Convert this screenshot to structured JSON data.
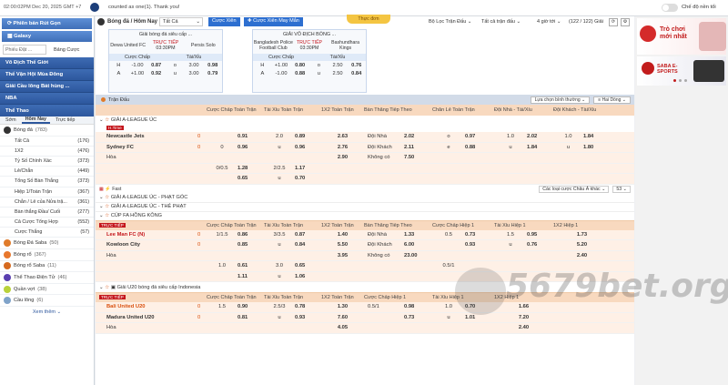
{
  "topbar": {
    "datetime": "02:00:02PM Dec 20, 2025 GMT +7",
    "marquee": "counted as one(1). Thank you!",
    "toggle_label": "Chế độ nền tối"
  },
  "sidebar": {
    "btn1": "Phiên bản Rút Gọn",
    "btn2": "Galaxy",
    "search_placeholder": "Phiếu Đặt ...",
    "betslip": "Bảng Cược",
    "cats": [
      "Vô Địch Thế Giới",
      "Thế Vận Hội Mùa Đông",
      "Giải Cầu lông Bát hùng ...",
      "NBA",
      "Thể Thao"
    ],
    "tabs": [
      "Sớm",
      "Hôm Nay",
      "Trực tiếp"
    ],
    "sport": {
      "name": "Bóng đá",
      "count": "(783)"
    },
    "subs": [
      {
        "l": "Tất Cả",
        "c": "(176)"
      },
      {
        "l": "1X2",
        "c": "(476)"
      },
      {
        "l": "Tỷ Số Chính Xác",
        "c": "(373)"
      },
      {
        "l": "Lẻ/Chẵn",
        "c": "(449)"
      },
      {
        "l": "Tổng Số Bàn Thắng",
        "c": "(373)"
      },
      {
        "l": "Hiệp 1/Toàn Trận",
        "c": "(367)"
      },
      {
        "l": "Chẵn / Lẻ của Nửa trậ...",
        "c": "(361)"
      },
      {
        "l": "Bàn thắng Đầu/ Cuối",
        "c": "(277)"
      },
      {
        "l": "Cả Cược Tổng Hợp",
        "c": "(552)"
      },
      {
        "l": "Cược Thắng",
        "c": "(57)"
      }
    ],
    "sports": [
      {
        "l": "Bóng Đá Saba",
        "c": "(50)"
      },
      {
        "l": "Bóng rổ",
        "c": "(367)"
      },
      {
        "l": "Bóng rổ Saba",
        "c": "(11)"
      },
      {
        "l": "Thể Thao Điện Tử",
        "c": "(46)"
      },
      {
        "l": "Quần vợt",
        "c": "(38)"
      },
      {
        "l": "Cầu lông",
        "c": "(6)"
      }
    ],
    "more": "Xem thêm"
  },
  "header": {
    "title": "Bóng đá / Hôm Nay",
    "filter": "Tất Cả",
    "btn_mix": "Cược Xiên",
    "btn_lucky": "Cược Xiên May Mắn",
    "deposit": "Thực đơn",
    "filter_league": "Bộ Lọc Trận Đấu",
    "filter_all": "Tất cả trận đấu",
    "filter_hours": "4 giờ tới",
    "count": "(122 / 122) Giải"
  },
  "cards": [
    {
      "league": "Giải bóng đá siêu cấp ...",
      "home": "Dewa United FC",
      "away": "Persis Solo",
      "live": "TRỰC TIẾP",
      "time": "03:30PM",
      "hcap": "Cược Chấp",
      "ou": "Tài/Xỉu",
      "r1": [
        "H",
        "-1.00",
        "0.87",
        "o",
        "3.00",
        "0.98"
      ],
      "r2": [
        "A",
        "+1.00",
        "0.92",
        "u",
        "3.00",
        "0.79"
      ]
    },
    {
      "league": "GIẢI VÔ ĐỊCH BÓNG ...",
      "home": "Bangladesh Police Football Club",
      "away": "Bashundhara Kings",
      "live": "TRỰC TIẾP",
      "time": "03:30PM",
      "hcap": "Cược Chấp",
      "ou": "Tài/Xỉu",
      "r1": [
        "H",
        "+1.00",
        "0.80",
        "o",
        "2.50",
        "0.76"
      ],
      "r2": [
        "A",
        "-1.00",
        "0.88",
        "u",
        "2.50",
        "0.84"
      ]
    }
  ],
  "ads": {
    "ad1": "Trò chơi mới nhất",
    "ad2": "SABA E-SPORTS"
  },
  "main": {
    "matches_label": "Trận Đấu",
    "sort": "Lựa chọn bình thường",
    "tab2": "Hai Dòng",
    "cols": [
      "Cược Chấp Toàn Trận",
      "Tài Xỉu Toàn Trận",
      "1X2 Toàn Trận",
      "Bàn Thắng Tiếp Theo",
      "Chẵn Lẻ Toàn Trận",
      "Đội Nhà - Tài/Xỉu",
      "Đội Khách - Tài/Xỉu"
    ],
    "cols2": [
      "Cược Chấp Toàn Trận",
      "Tài Xỉu Toàn Trận",
      "1X2 Toàn Trận",
      "Bàn Thắng Tiếp Theo",
      "Cược Chấp Hiệp 1",
      "Tài Xỉu Hiệp 1",
      "1X2 Hiệp 1"
    ],
    "l1": "GIẢI A-LEAGUE ÚC",
    "tag1": "H.Time",
    "m1": {
      "home": "Newcastle Jets",
      "away": "Sydney FC",
      "draw": "Hòa",
      "hs": "0",
      "as": "0",
      "r1": [
        "",
        "0.91",
        "2.0",
        "0.89",
        "2.63",
        "Đội Nhà",
        "2.02",
        "o",
        "0.97",
        "1.0",
        "2.02",
        "1.0",
        "1.84"
      ],
      "r2": [
        "0",
        "0.96",
        "u",
        "0.96",
        "2.76",
        "Đội Khách",
        "2.11",
        "e",
        "0.88",
        "u",
        "1.84",
        "u",
        "1.80"
      ],
      "r3": [
        "",
        "",
        "",
        "",
        "2.90",
        "Không có",
        "7.50"
      ],
      "r4": [
        "0/0.5",
        "1.28",
        "2/2.5",
        "1.17"
      ],
      "r5": [
        "",
        "0.65",
        "u",
        "0.70"
      ]
    },
    "fast": "Fast",
    "sort2": "Các loại cược Châu Á khác",
    "size": "53",
    "l2": "GIẢI A-LEAGUE ÚC - PHẠT GÓC",
    "l3": "GIẢI A-LEAGUE ÚC - THẺ PHẠT",
    "l4": "CÚP FA HỒNG KÔNG",
    "m2": {
      "home": "Lee Man FC (N)",
      "away": "Kowloon City",
      "draw": "Hòa",
      "hs": "0",
      "as": "0",
      "r1": [
        "1/1.5",
        "0.86",
        "3/3.5",
        "0.87",
        "1.40",
        "Đội Nhà",
        "1.33",
        "0.5",
        "0.73",
        "1.5",
        "0.95",
        "1.73"
      ],
      "r2": [
        "",
        "0.85",
        "u",
        "0.84",
        "5.50",
        "Đội Khách",
        "6.00",
        "",
        "0.93",
        "u",
        "0.76",
        "5.20"
      ],
      "r3": [
        "",
        "",
        "",
        "",
        "3.95",
        "Không có",
        "23.00",
        "",
        "",
        "",
        "",
        "2.40"
      ],
      "r4": [
        "1.0",
        "0.61",
        "3.0",
        "0.65",
        "",
        "",
        "",
        "0.5/1",
        "",
        "",
        "",
        ""
      ],
      "r5": [
        "",
        "1.11",
        "u",
        "1.06"
      ]
    },
    "l5": "Giải U20 bóng đá siêu cấp Indonesia",
    "m3": {
      "home": "Bali United U20",
      "away": "Madura United U20",
      "draw": "Hòa",
      "hs": "0",
      "as": "0",
      "r1": [
        "1.5",
        "0.90",
        "2.5/3",
        "0.78",
        "1.30",
        "0.5/1",
        "0.98",
        "1.0",
        "0.70",
        "1.66"
      ],
      "r2": [
        "",
        "0.81",
        "u",
        "0.93",
        "7.60",
        "",
        "0.73",
        "u",
        "1.01",
        "7.20"
      ],
      "r3": [
        "",
        "",
        "",
        "",
        "4.05",
        "",
        "",
        "",
        "",
        "2.40"
      ]
    }
  },
  "watermark": "5679bet.org",
  "live_tag": "TRỰC TIẾP"
}
